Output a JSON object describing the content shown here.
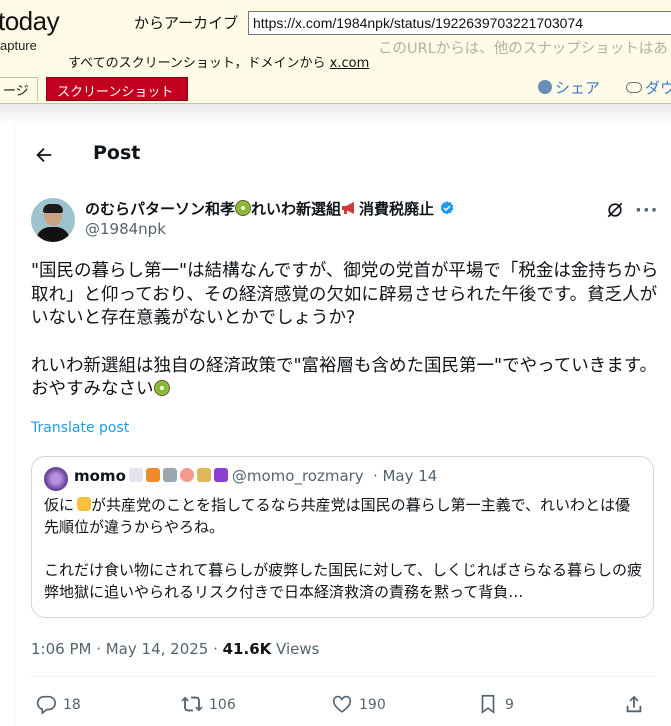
{
  "archive": {
    "logo": "today",
    "logo_sub": "apture",
    "from_label": "からアーカイブ",
    "url": "https://x.com/1984npk/status/1922639703221703074",
    "hint": "このURLからは、他のスナップショットはあ",
    "all_shots_label": "すべてのスクリーンショット，ドメインから",
    "domain_link": "x.com",
    "tab_page": "ージ",
    "tab_screenshot": "スクリーンショット",
    "share_label": "シェア",
    "download_label": "ダウ"
  },
  "header": {
    "title": "Post"
  },
  "author": {
    "name_part1": "のむらパターソン和孝",
    "name_part2": "れいわ新選組",
    "name_part3": "消費税廃止",
    "handle": "@1984npk"
  },
  "tweet": {
    "text": "\"国民の暮らし第一\"は結構なんですが、御党の党首が平場で「税金は金持ちから取れ」と仰っており、その経済感覚の欠如に辟易させられた午後です。貧乏人がいないと存在意義がないとかでしょうか?\n\nれいわ新選組は独自の経済政策で\"富裕層も含めた国民第一\"でやっていきます。おやすみなさい",
    "translate": "Translate post"
  },
  "quote": {
    "name": "momo",
    "handle": "@momo_rozmary",
    "date": "· May 14",
    "text_part1": "仮に",
    "text_part2": "が共産党のことを指してるなら共産党は国民の暮らし第一主義で、れいわとは優先順位が違うからやろね。\n\nこれだけ食い物にされて暮らしが疲弊した国民に対して、しくじればさらなる暮らしの疲弊地獄に追いやられるリスク付きで日本経済救済の責務を黙って背負…"
  },
  "meta": {
    "time": "1:06 PM · May 14, 2025 · ",
    "views_count": "41.6K",
    "views_label": " Views"
  },
  "actions": {
    "replies": "18",
    "reposts": "106",
    "likes": "190",
    "bookmarks": "9"
  },
  "colors": {
    "accent": "#1d9bf0",
    "archive_red": "#c0001e",
    "muted": "#536471"
  }
}
